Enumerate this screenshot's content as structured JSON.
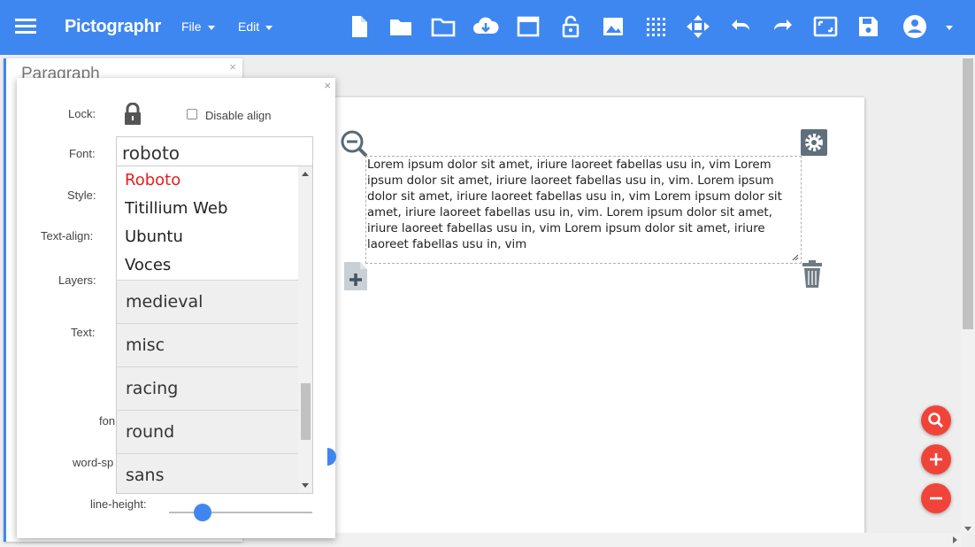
{
  "app": {
    "title": "Pictographr"
  },
  "menus": {
    "file": "File",
    "edit": "Edit"
  },
  "toolbar_icons": [
    "new-document-icon",
    "open-folder-icon",
    "folder-outline-icon",
    "cloud-download-icon",
    "window-icon",
    "lock-open-icon",
    "image-icon",
    "grid-icon",
    "move-icon",
    "undo-icon",
    "redo-icon",
    "fit-screen-icon",
    "save-icon",
    "account-icon"
  ],
  "paragraph_panel": {
    "title": "Paragraph",
    "close": "×"
  },
  "settings": {
    "close": "×",
    "lock_label": "Lock:",
    "disable_align_label": "Disable align",
    "font_label": "Font:",
    "font_value": "roboto",
    "style_label": "Style:",
    "text_align_label": "Text-align:",
    "layers_label": "Layers:",
    "text_label": "Text:",
    "font_size_label_partial": "fon",
    "word_spacing_label_partial": "word-sp",
    "line_height_label": "line-height:"
  },
  "font_dropdown": {
    "fonts": [
      "Roboto",
      "Titillium Web",
      "Ubuntu",
      "Voces"
    ],
    "selected": "Roboto",
    "categories": [
      "medieval",
      "misc",
      "racing",
      "round",
      "sans"
    ]
  },
  "canvas": {
    "paragraph_text": "Lorem ipsum dolor sit amet, iriure laoreet fabellas usu in, vim Lorem ipsum dolor sit amet, iriure laoreet fabellas usu in, vim. Lorem ipsum dolor sit amet, iriure laoreet fabellas usu in, vim Lorem ipsum dolor sit amet, iriure laoreet fabellas usu in, vim. Lorem ipsum dolor sit amet, iriure laoreet fabellas usu in, vim Lorem ipsum dolor sit amet, iriure laoreet fabellas usu in, vim"
  },
  "colors": {
    "accent": "#3f87f0",
    "fab": "#f0443a",
    "selected_font": "#e51d1d"
  }
}
